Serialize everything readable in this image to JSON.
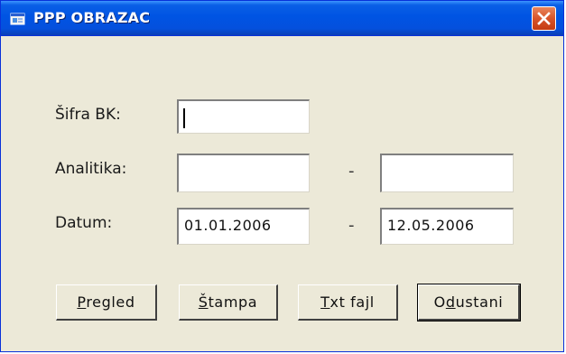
{
  "window": {
    "title": "PPP OBRAZAC",
    "close_icon": "close-icon",
    "app_icon": "window-app-icon"
  },
  "form": {
    "sifra_label": "Šifra BK:",
    "sifra_value": "",
    "analitika_label": "Analitika:",
    "analitika_from": "",
    "analitika_separator": "-",
    "analitika_to": "",
    "datum_label": "Datum:",
    "datum_from": "01.01.2006",
    "datum_separator": "-",
    "datum_to": "12.05.2006"
  },
  "buttons": {
    "pregled": {
      "accel": "P",
      "rest": "regled"
    },
    "stampa": {
      "accel": "Š",
      "rest": "tampa"
    },
    "txt": {
      "accel": "T",
      "rest": "xt fajl"
    },
    "odustani": {
      "pre": "O",
      "accel": "d",
      "rest": "ustani"
    }
  },
  "colors": {
    "titlebar": "#0054e3",
    "window_bg": "#ece9d8",
    "close_button": "#d8542a"
  }
}
